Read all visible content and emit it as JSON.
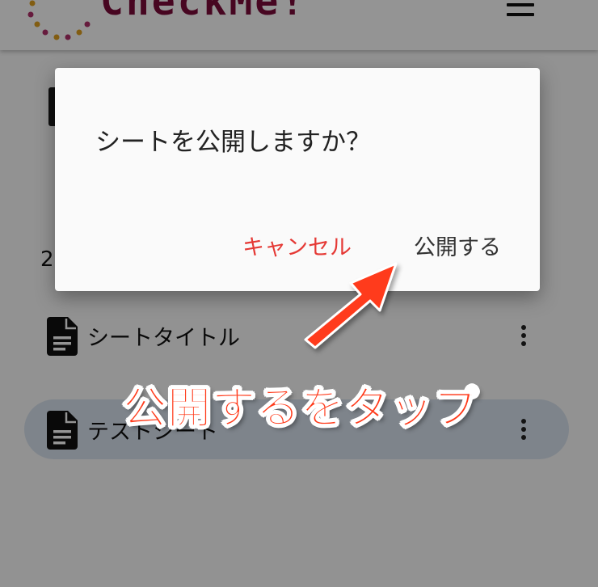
{
  "app": {
    "logo_text": "CheckMe!",
    "menu_icon": "hamburger-menu-icon"
  },
  "list": {
    "count_text": "2",
    "sheets": [
      {
        "title": "シートタイトル",
        "icon": "document-icon",
        "menu_icon": "more-vert-icon"
      },
      {
        "title": "テストシート",
        "icon": "document-icon",
        "menu_icon": "more-vert-icon"
      }
    ]
  },
  "dialog": {
    "title": "シートを公開しますか？",
    "cancel_label": "キャンセル",
    "confirm_label": "公開する"
  },
  "annotation": {
    "text": "公開するをタップ",
    "color": "#ff3a1a"
  },
  "colors": {
    "cancel": "#e53935",
    "selected_row": "#d9e3ef",
    "logo": "#7a0b3a"
  }
}
